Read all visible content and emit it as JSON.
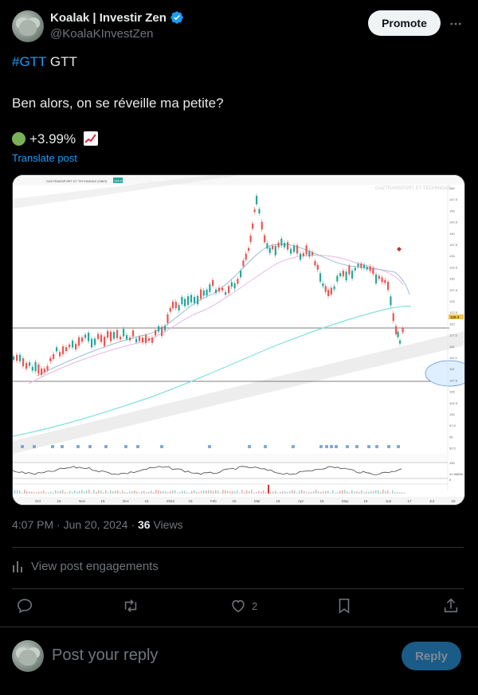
{
  "author": {
    "display_name": "Koalak | Investir Zen",
    "handle": "@KoalaKInvestZen"
  },
  "header": {
    "promote_label": "Promote",
    "more_icon": "more-dots-icon"
  },
  "post": {
    "hashtag": "#GTT",
    "ticker": "GTT",
    "line2": "Ben alors, on se réveille ma petite?",
    "change": "+3.99%",
    "emoji_dot": "green-circle-icon",
    "emoji_chart": "chart-increasing-icon",
    "translate_label": "Translate post"
  },
  "chart_image": {
    "watermark": "GAZTRANSPORT ET TECHNIGAZ",
    "header_title": "GAZTRANSPORT ET TECHNIGAZ (GBIS)",
    "header_badge": "134.5",
    "price_labels": [
      "160",
      "147.5",
      "145",
      "142.5",
      "140",
      "137.5",
      "135",
      "132.5",
      "130",
      "127.5",
      "125",
      "122.5",
      "120",
      "117.5",
      "115",
      "112.5",
      "110",
      "107.5",
      "105",
      "102.5",
      "100",
      "97.5",
      "95",
      "92.5"
    ],
    "current_price": "125.3",
    "x_labels": [
      "Oct",
      "16",
      "Nov",
      "15",
      "Dec",
      "15",
      "2024",
      "15",
      "Feb",
      "15",
      "Mar",
      "15",
      "Apr",
      "15",
      "May",
      "15",
      "Jun",
      "17",
      "Jul",
      "15"
    ],
    "rsi_axis": [
      "100",
      "41.96836",
      "0"
    ],
    "accent_colors": {
      "up": "#26a69a",
      "down": "#ef5350",
      "ma_long": "#7fe0dd",
      "ma_short": "#e8b5e6",
      "ma_mid": "#8fb8cf"
    }
  },
  "meta": {
    "time": "4:07 PM · Jun 20, 2024",
    "sep": "·",
    "views_count": "36",
    "views_label": "Views"
  },
  "engagements_label": "View post engagements",
  "actions": {
    "reply_icon": "reply-icon",
    "repost_icon": "repost-icon",
    "like_icon": "heart-icon",
    "like_count": "2",
    "bookmark_icon": "bookmark-icon",
    "share_icon": "share-icon"
  },
  "reply": {
    "placeholder": "Post your reply",
    "button_label": "Reply"
  }
}
